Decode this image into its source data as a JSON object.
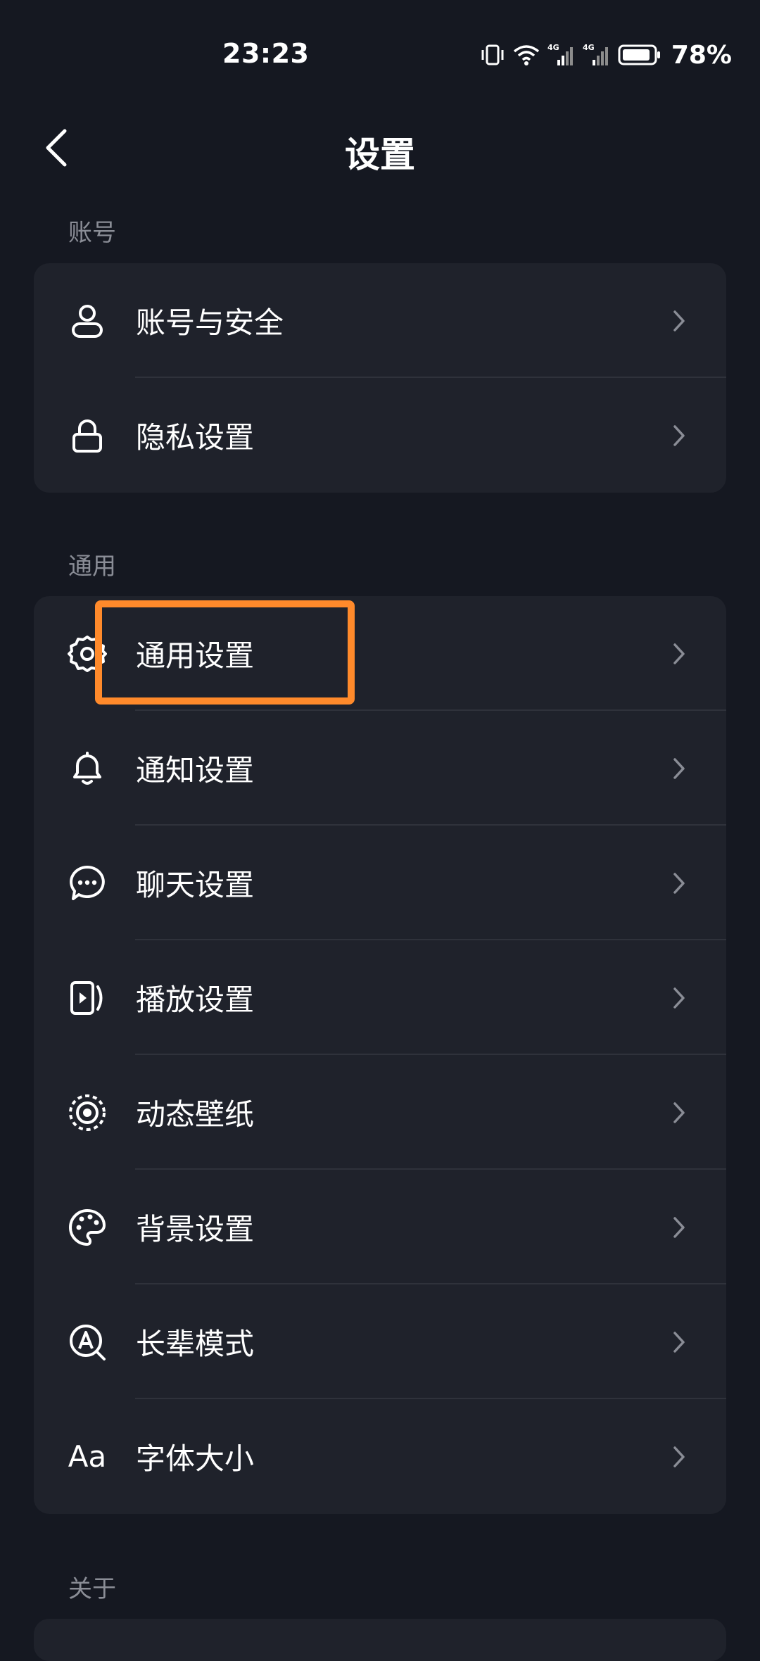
{
  "status_bar": {
    "time": "23:23",
    "battery_percent": "78%",
    "network_1": "4G",
    "network_2": "4G"
  },
  "header": {
    "title": "设置"
  },
  "sections": [
    {
      "label": "账号",
      "items": [
        {
          "label": "账号与安全",
          "icon": "user-icon"
        },
        {
          "label": "隐私设置",
          "icon": "lock-icon"
        }
      ]
    },
    {
      "label": "通用",
      "items": [
        {
          "label": "通用设置",
          "icon": "gear-icon"
        },
        {
          "label": "通知设置",
          "icon": "bell-icon"
        },
        {
          "label": "聊天设置",
          "icon": "chat-icon"
        },
        {
          "label": "播放设置",
          "icon": "play-icon"
        },
        {
          "label": "动态壁纸",
          "icon": "wallpaper-icon"
        },
        {
          "label": "背景设置",
          "icon": "palette-icon"
        },
        {
          "label": "长辈模式",
          "icon": "elder-mode-icon"
        },
        {
          "label": "字体大小",
          "icon": "font-size-icon",
          "icon_text": "Aa"
        }
      ]
    },
    {
      "label": "关于",
      "items": []
    }
  ],
  "colors": {
    "background": "#151821",
    "card": "#1f222b",
    "highlight": "#ff8a2b",
    "secondary_text": "#8a8d96"
  }
}
